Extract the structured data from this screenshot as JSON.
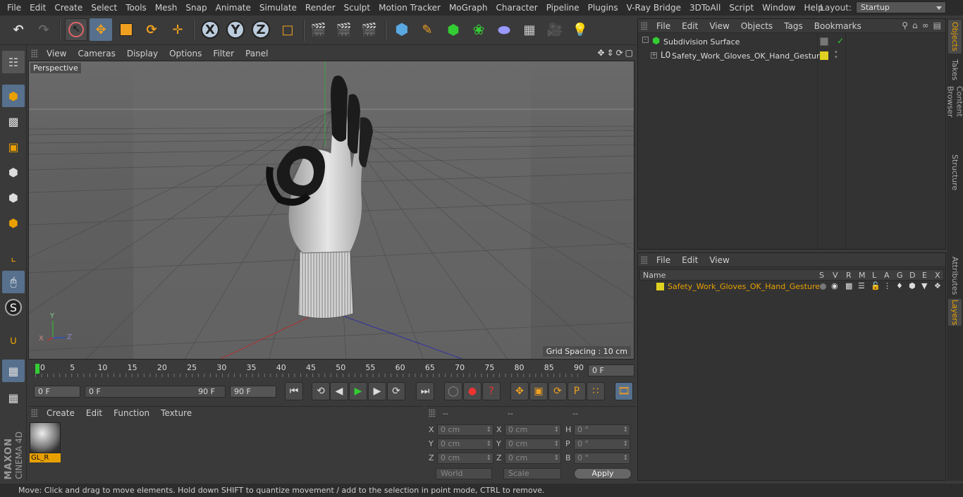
{
  "menubar": {
    "items": [
      "File",
      "Edit",
      "Create",
      "Select",
      "Tools",
      "Mesh",
      "Snap",
      "Animate",
      "Simulate",
      "Render",
      "Sculpt",
      "Motion Tracker",
      "MoGraph",
      "Character",
      "Pipeline",
      "Plugins",
      "V-Ray Bridge",
      "3DToAll",
      "Script",
      "Window",
      "Help"
    ],
    "layout_label": "Layout:",
    "layout_value": "Startup"
  },
  "viewport": {
    "menu": [
      "View",
      "Cameras",
      "Display",
      "Options",
      "Filter",
      "Panel"
    ],
    "label": "Perspective",
    "grid_spacing": "Grid Spacing : 10 cm",
    "axes": {
      "y": "Y",
      "x": "X",
      "z": "Z"
    }
  },
  "timeline": {
    "ticks": [
      "0",
      "5",
      "10",
      "15",
      "20",
      "25",
      "30",
      "35",
      "40",
      "45",
      "50",
      "55",
      "60",
      "65",
      "70",
      "75",
      "80",
      "85",
      "90"
    ],
    "current_frame": "0 F"
  },
  "transport": {
    "start_field": "0 F",
    "range_start": "0 F",
    "range_end": "90 F",
    "end_field": "90 F"
  },
  "material_panel": {
    "menu": [
      "Create",
      "Edit",
      "Function",
      "Texture"
    ],
    "material_name": "GL_R"
  },
  "coord_panel": {
    "headers": [
      "--",
      "--",
      "--"
    ],
    "rows": [
      {
        "l1": "X",
        "v1": "0 cm",
        "l2": "X",
        "v2": "0 cm",
        "l3": "H",
        "v3": "0 °"
      },
      {
        "l1": "Y",
        "v1": "0 cm",
        "l2": "Y",
        "v2": "0 cm",
        "l3": "P",
        "v3": "0 °"
      },
      {
        "l1": "Z",
        "v1": "0 cm",
        "l2": "Z",
        "v2": "0 cm",
        "l3": "B",
        "v3": "0 °"
      }
    ],
    "world": "World",
    "scale": "Scale",
    "apply": "Apply"
  },
  "object_manager": {
    "menu": [
      "File",
      "Edit",
      "View",
      "Objects",
      "Tags",
      "Bookmarks"
    ],
    "items": [
      {
        "name": "Subdivision Surface"
      },
      {
        "name": "Safety_Work_Gloves_OK_Hand_Gesture"
      }
    ]
  },
  "layer_manager": {
    "menu": [
      "File",
      "Edit",
      "View"
    ],
    "columns": [
      "Name",
      "S",
      "V",
      "R",
      "M",
      "L",
      "A",
      "G",
      "D",
      "E",
      "X"
    ],
    "layer_name": "Safety_Work_Gloves_OK_Hand_Gesture",
    "layer_color": "#e0d020"
  },
  "right_tabs": [
    "Objects",
    "Takes",
    "Content Browser",
    "Structure",
    "Attributes",
    "Layers"
  ],
  "branding": {
    "maxon": "MAXON",
    "cinema": "CINEMA 4D"
  },
  "status": "Move: Click and drag to move elements. Hold down SHIFT to quantize movement / add to the selection in point mode, CTRL to remove."
}
